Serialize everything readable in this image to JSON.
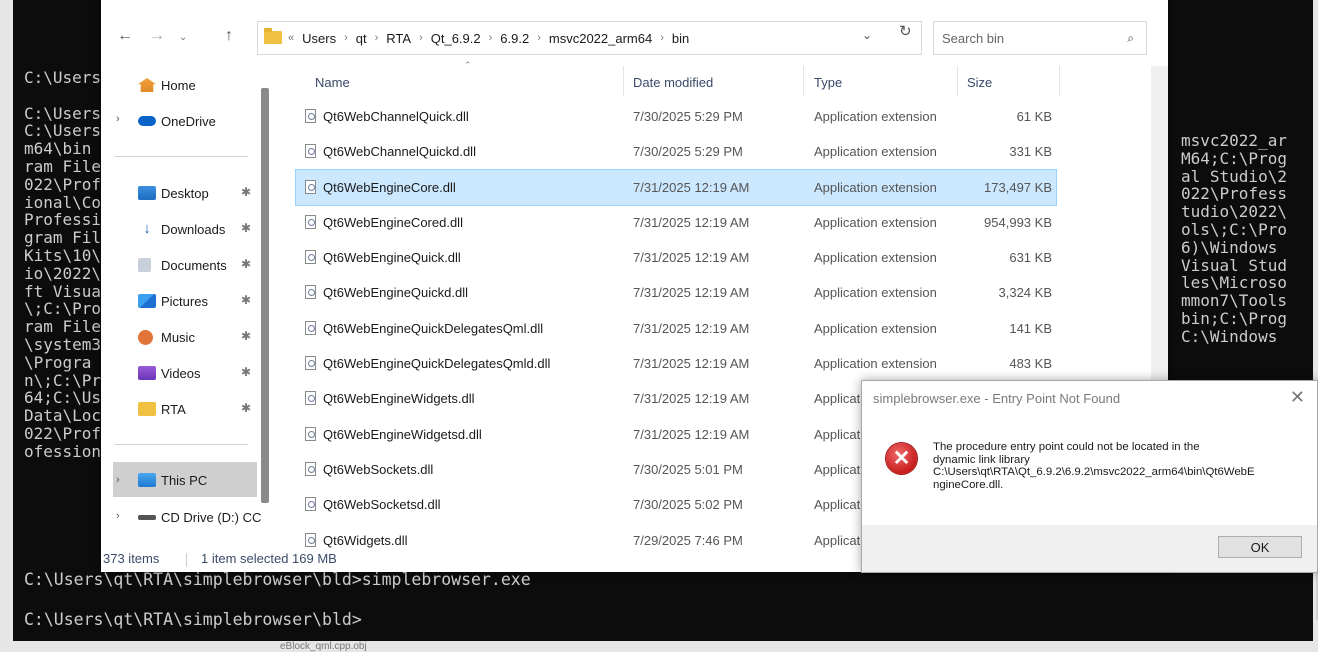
{
  "console": {
    "left_lines": [
      "C:\\Users",
      "",
      "C:\\Users",
      "C:\\Users",
      "m64\\bin",
      "ram File",
      "022\\Prof",
      "ional\\Co",
      "Professi",
      "gram Fil",
      "Kits\\10\\",
      "io\\2022\\",
      "ft Visua",
      "\\;C:\\Pro",
      "ram File",
      "\\system3",
      "\\Progra",
      "n\\;C:\\Pr",
      "64;C:\\Us",
      "Data\\Loc",
      "022\\Prof",
      "ofession"
    ],
    "right_lines": [
      "msvc2022_ar",
      "M64;C:\\Prog",
      "al Studio\\2",
      "022\\Profess",
      "tudio\\2022\\",
      "ols\\;C:\\Pro",
      "6)\\Windows ",
      "Visual Stud",
      "les\\Microso",
      "mmon7\\Tools",
      "bin;C:\\Prog",
      "C:\\Windows"
    ],
    "bottom_lines": [
      "C:\\Users\\qt\\RTA\\simplebrowser\\bld>simplebrowser.exe",
      "",
      "C:\\Users\\qt\\RTA\\simplebrowser\\bld>"
    ],
    "behind_text": "eBlock_qml.cpp.obj"
  },
  "explorer": {
    "breadcrumb": [
      "Users",
      "qt",
      "RTA",
      "Qt_6.9.2",
      "6.9.2",
      "msvc2022_arm64",
      "bin"
    ],
    "breadcrumb_lead": "«",
    "search_placeholder": "Search bin",
    "nav": {
      "home": "Home",
      "onedrive": "OneDrive",
      "desktop": "Desktop",
      "downloads": "Downloads",
      "documents": "Documents",
      "pictures": "Pictures",
      "music": "Music",
      "videos": "Videos",
      "rta": "RTA",
      "this_pc": "This PC",
      "cd_drive": "CD Drive (D:) CC"
    },
    "columns": {
      "name": "Name",
      "date": "Date modified",
      "type": "Type",
      "size": "Size"
    },
    "files": [
      {
        "name": "Qt6WebChannelQuick.dll",
        "date": "7/30/2025 5:29 PM",
        "type": "Application extension",
        "size": "61 KB"
      },
      {
        "name": "Qt6WebChannelQuickd.dll",
        "date": "7/30/2025 5:29 PM",
        "type": "Application extension",
        "size": "331 KB"
      },
      {
        "name": "Qt6WebEngineCore.dll",
        "date": "7/31/2025 12:19 AM",
        "type": "Application extension",
        "size": "173,497 KB"
      },
      {
        "name": "Qt6WebEngineCored.dll",
        "date": "7/31/2025 12:19 AM",
        "type": "Application extension",
        "size": "954,993 KB"
      },
      {
        "name": "Qt6WebEngineQuick.dll",
        "date": "7/31/2025 12:19 AM",
        "type": "Application extension",
        "size": "631 KB"
      },
      {
        "name": "Qt6WebEngineQuickd.dll",
        "date": "7/31/2025 12:19 AM",
        "type": "Application extension",
        "size": "3,324 KB"
      },
      {
        "name": "Qt6WebEngineQuickDelegatesQml.dll",
        "date": "7/31/2025 12:19 AM",
        "type": "Application extension",
        "size": "141 KB"
      },
      {
        "name": "Qt6WebEngineQuickDelegatesQmld.dll",
        "date": "7/31/2025 12:19 AM",
        "type": "Application extension",
        "size": "483 KB"
      },
      {
        "name": "Qt6WebEngineWidgets.dll",
        "date": "7/31/2025 12:19 AM",
        "type": "Applicat",
        "size": ""
      },
      {
        "name": "Qt6WebEngineWidgetsd.dll",
        "date": "7/31/2025 12:19 AM",
        "type": "Applicat",
        "size": ""
      },
      {
        "name": "Qt6WebSockets.dll",
        "date": "7/30/2025 5:01 PM",
        "type": "Applicat",
        "size": ""
      },
      {
        "name": "Qt6WebSocketsd.dll",
        "date": "7/30/2025 5:02 PM",
        "type": "Applicat",
        "size": ""
      },
      {
        "name": "Qt6Widgets.dll",
        "date": "7/29/2025 7:46 PM",
        "type": "Applicat",
        "size": ""
      }
    ],
    "selected_index": 2,
    "status": {
      "count": "373 items",
      "selection": "1 item selected  169 MB"
    }
  },
  "dialog": {
    "title": "simplebrowser.exe - Entry Point Not Found",
    "message_lines": [
      "The procedure entry point  could not be located in the",
      "dynamic link library",
      "C:\\Users\\qt\\RTA\\Qt_6.9.2\\6.9.2\\msvc2022_arm64\\bin\\Qt6WebE",
      "ngineCore.dll."
    ],
    "ok_label": "OK"
  },
  "colors": {
    "selection": "#cce8ff",
    "console_bg": "#0c0c0c",
    "error_red": "#c81d1d"
  }
}
